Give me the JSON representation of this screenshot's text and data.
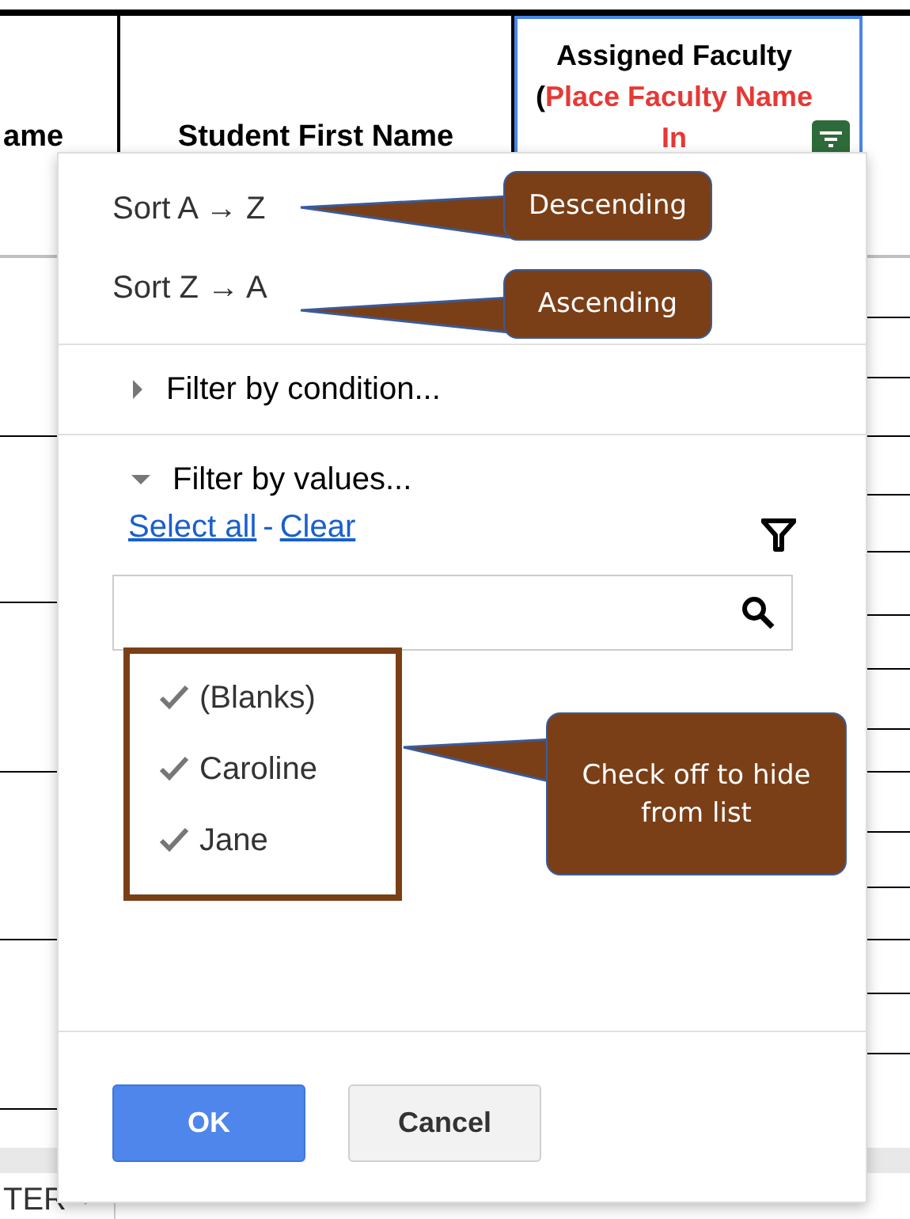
{
  "columns": [
    {
      "title_parts": [
        {
          "text": "ame",
          "kind": "plain"
        }
      ],
      "selected": false,
      "filter_button": false
    },
    {
      "title_parts": [
        {
          "text": "Student First Name",
          "kind": "plain"
        }
      ],
      "selected": false,
      "filter_button": false
    },
    {
      "title_parts": [
        {
          "text": "Assigned Faculty (",
          "kind": "plain"
        },
        {
          "text": "Place Faculty Name In",
          "kind": "highlight"
        }
      ],
      "selected": true,
      "filter_button": true
    }
  ],
  "menu": {
    "sort_options": [
      "Sort A → Z",
      "Sort Z → A"
    ],
    "sections": [
      {
        "label": "Filter by condition...",
        "expanded": false
      },
      {
        "label": "Filter by values...",
        "expanded": true
      }
    ],
    "select_all": "Select all",
    "separator": "-",
    "clear": "Clear",
    "values": [
      {
        "label": "(Blanks)",
        "checked": true
      },
      {
        "label": "Caroline",
        "checked": true
      },
      {
        "label": "Jane",
        "checked": true
      }
    ],
    "buttons": [
      {
        "label": "OK",
        "kind": "primary"
      },
      {
        "label": "Cancel",
        "kind": "secondary"
      }
    ]
  },
  "callouts": [
    {
      "text": "Descending"
    },
    {
      "text": "Ascending"
    },
    {
      "text": "Check off to hide from list"
    }
  ],
  "sheet_tab": {
    "label": "TER"
  }
}
